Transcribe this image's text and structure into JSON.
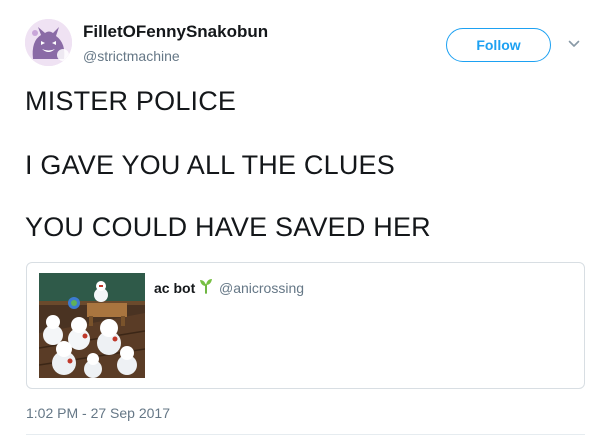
{
  "author": {
    "display_name": "FilletOFennySnakobun",
    "handle": "@strictmachine",
    "avatar_icon": "gengar-avatar-icon"
  },
  "follow": {
    "label": "Follow",
    "accent": "#1da1f2"
  },
  "menu": {
    "icon": "chevron-down-icon"
  },
  "tweet": {
    "lines": [
      "MISTER POLICE",
      "I GAVE YOU ALL THE CLUES",
      "YOU COULD HAVE SAVED HER"
    ]
  },
  "quoted_tweet": {
    "display_name": "ac bot",
    "badge_icon": "sprout-icon",
    "handle": "@anicrossing",
    "media": "snowmen-room-thumbnail"
  },
  "timestamp": "1:02 PM - 27 Sep 2017"
}
